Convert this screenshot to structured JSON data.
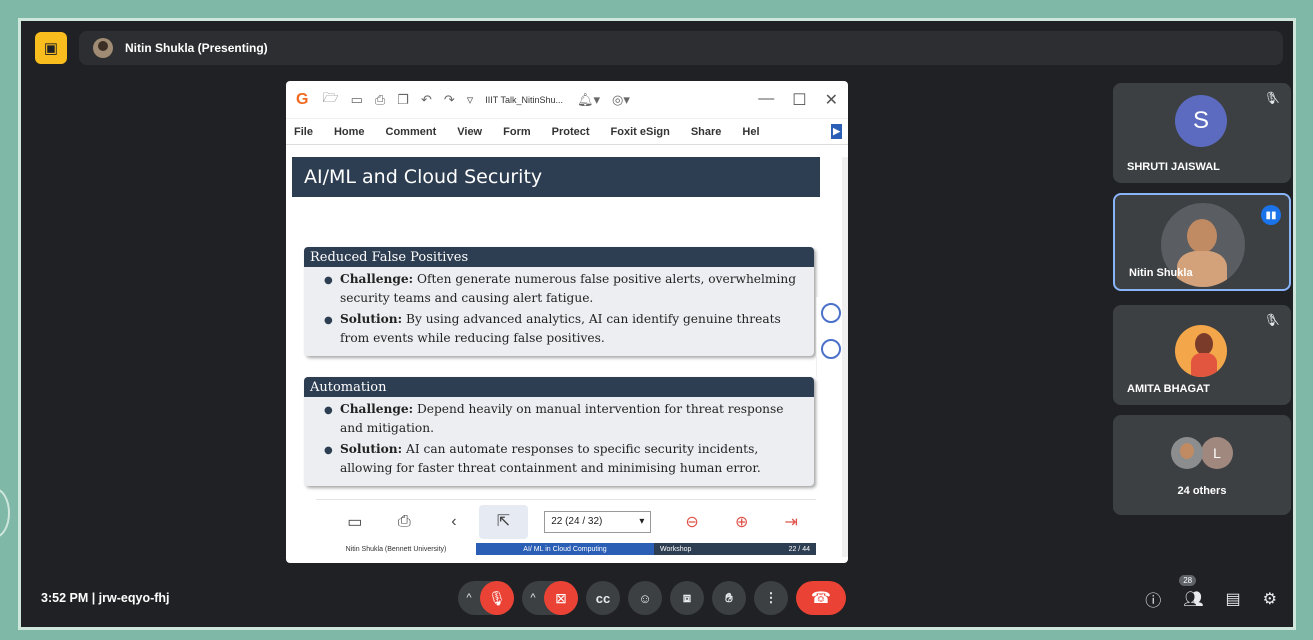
{
  "topbar": {
    "presenter_label": "Nitin Shukla (Presenting)"
  },
  "window": {
    "doc_name": "IIIT Talk_NitinShu...",
    "menu": [
      "File",
      "Home",
      "Comment",
      "View",
      "Form",
      "Protect",
      "Foxit eSign",
      "Share",
      "Hel"
    ],
    "slide": {
      "title": "AI/ML and Cloud Security",
      "blocks": [
        {
          "heading": "Reduced False Positives",
          "items": [
            {
              "label": "Challenge:",
              "text": "Often generate numerous false positive alerts, overwhelming security teams and causing alert fatigue."
            },
            {
              "label": "Solution:",
              "text": "By using advanced analytics, AI can identify genuine threats from events while reducing false positives."
            }
          ]
        },
        {
          "heading": "Automation",
          "items": [
            {
              "label": "Challenge:",
              "text": "Depend heavily on manual intervention for threat response and mitigation."
            },
            {
              "label": "Solution:",
              "text": "AI can automate responses to specific security incidents, allowing for faster threat containment and minimising human error."
            }
          ]
        }
      ],
      "footer": {
        "author": "Nitin Shukla (Bennett University)",
        "course": "AI/ ML in Cloud Computing",
        "event": "Workshop",
        "page": "22 / 44"
      }
    },
    "reader": {
      "page_value": "22 (24 / 32)"
    }
  },
  "participants": {
    "shruti": {
      "initial": "S",
      "name": "SHRUTI JAISWAL"
    },
    "nitin": {
      "name": "Nitin Shukla"
    },
    "amita": {
      "name": "AMITA BHAGAT"
    },
    "others": {
      "initial": "L",
      "label": "24 others"
    }
  },
  "bottombar": {
    "time_meeting": "3:52 PM  |  jrw-eqyo-fhj",
    "people_count": "28"
  },
  "colors": {
    "accent_red": "#ea4335",
    "present_yellow": "#f9bd1d",
    "slide_navy": "#2e3e52",
    "speaking_blue": "#1a73e8"
  }
}
